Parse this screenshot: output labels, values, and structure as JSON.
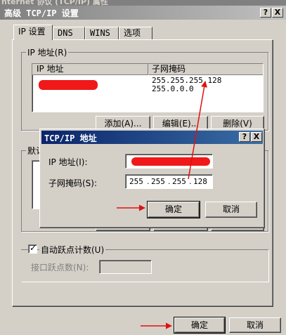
{
  "window": {
    "top_partial_title": "nternet 协议 (TCP/IP) 属性",
    "title": "高级 TCP/IP 设置",
    "help_btn": "?",
    "close_btn": "X"
  },
  "tabs": [
    "IP 设置",
    "DNS",
    "WINS",
    "选项"
  ],
  "ip_group": {
    "label": "IP 地址(R)",
    "columns": [
      "IP 地址",
      "子网掩码"
    ],
    "masks": [
      "255.255.255.128",
      "255.0.0.0"
    ],
    "buttons": [
      "添加(A)...",
      "编辑(E)...",
      "删除(V)"
    ]
  },
  "gateway_group_label_partial": "默认",
  "metric": {
    "checkbox_label": "自动跃点计数(U)",
    "checked": true,
    "interface_metric_label": "接口跃点数(N):",
    "interface_metric_value": ""
  },
  "footer": {
    "ok": "确定",
    "cancel": "取消"
  },
  "dialog": {
    "title": "TCP/IP 地址",
    "help_btn": "?",
    "close_btn": "X",
    "ip_label": "IP 地址(I):",
    "mask_label": "子网掩码(S):",
    "mask_octets": [
      "255",
      "255",
      "255",
      "128"
    ],
    "ok": "确定",
    "cancel": "取消"
  },
  "colors": {
    "title_active": "#0a246a",
    "title_inactive": "#808080",
    "face": "#d4d0c8",
    "annotation_red": "#e01010"
  }
}
